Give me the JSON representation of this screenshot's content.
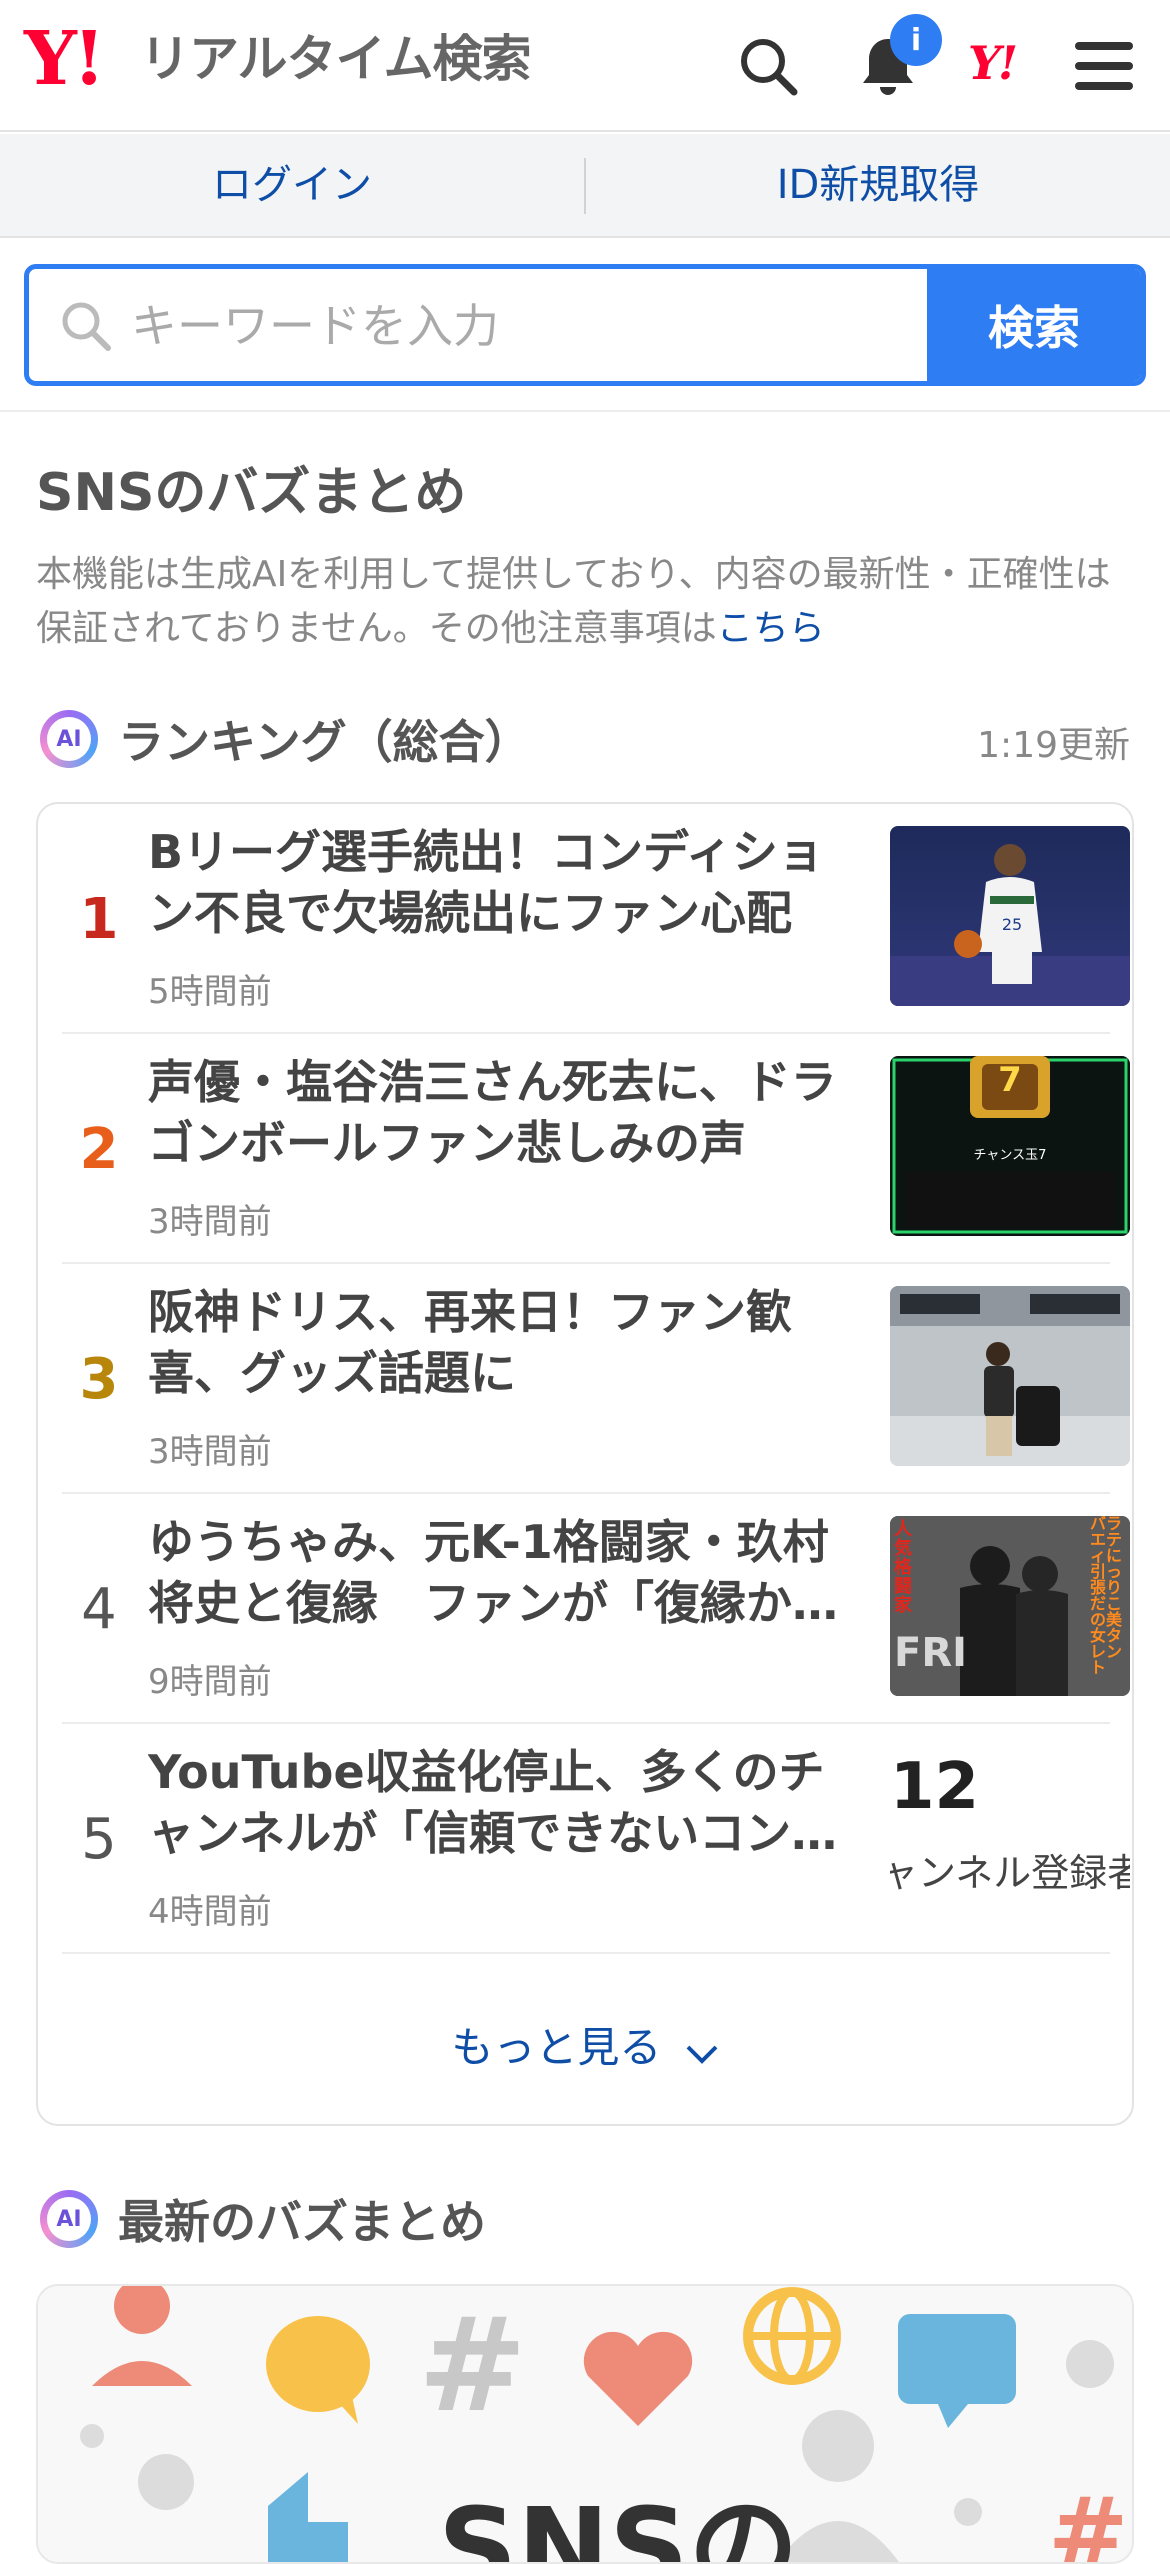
{
  "header": {
    "logo_mark": "Y!",
    "service_name": "リアルタイム検索",
    "notification_badge": "i",
    "mini_logo": "Y!",
    "icons": [
      "search-icon",
      "bell-icon",
      "yahoo-logo-icon",
      "hamburger-menu-icon"
    ]
  },
  "auth": {
    "login": "ログイン",
    "signup": "ID新規取得"
  },
  "search": {
    "placeholder": "キーワードを入力",
    "button": "検索"
  },
  "buzz": {
    "title": "SNSのバズまとめ",
    "note": "本機能は生成AIを利用して提供しており、内容の最新性・正確性は保証されておりません。その他注意事項は",
    "note_link": "こちら"
  },
  "ranking": {
    "ai_badge": "AI",
    "title": "ランキング（総合）",
    "updated": "1:19更新",
    "items": [
      {
        "rank": "1",
        "title": "Bリーグ選手続出！コンディション不良で欠場続出にファン心配",
        "time": "5時間前",
        "rank_color": "#c8291f"
      },
      {
        "rank": "2",
        "title": "声優・塩谷浩三さん死去に、ドラゴンボールファン悲しみの声",
        "time": "3時間前",
        "rank_color": "#e85f1c",
        "thumb_badge": "7",
        "thumb_caption": "チャンス玉7"
      },
      {
        "rank": "3",
        "title": "阪神ドリス、再来日！ファン歓喜、グッズ話題に",
        "time": "3時間前",
        "rank_color": "#b8860b"
      },
      {
        "rank": "4",
        "title": "ゆうちゃみ、元K-1格闘家・玖村将史と復縁　ファンが「復縁か…",
        "time": "9時間前",
        "rank_color": "#555555",
        "thumb_text_red": "人気格闘家",
        "thumb_text_orange": "バラエティに引っ張りだこの美女タレント"
      },
      {
        "rank": "5",
        "title": "YouTube収益化停止、多くのチャンネルが「信頼できないコン…",
        "time": "4時間前",
        "rank_color": "#555555",
        "thumb_number": "12",
        "thumb_caption": "ャンネル登録者数"
      }
    ],
    "more": "もっと見る"
  },
  "latest": {
    "ai_badge": "AI",
    "title": "最新のバズまとめ",
    "banner_text": "SNSの"
  }
}
